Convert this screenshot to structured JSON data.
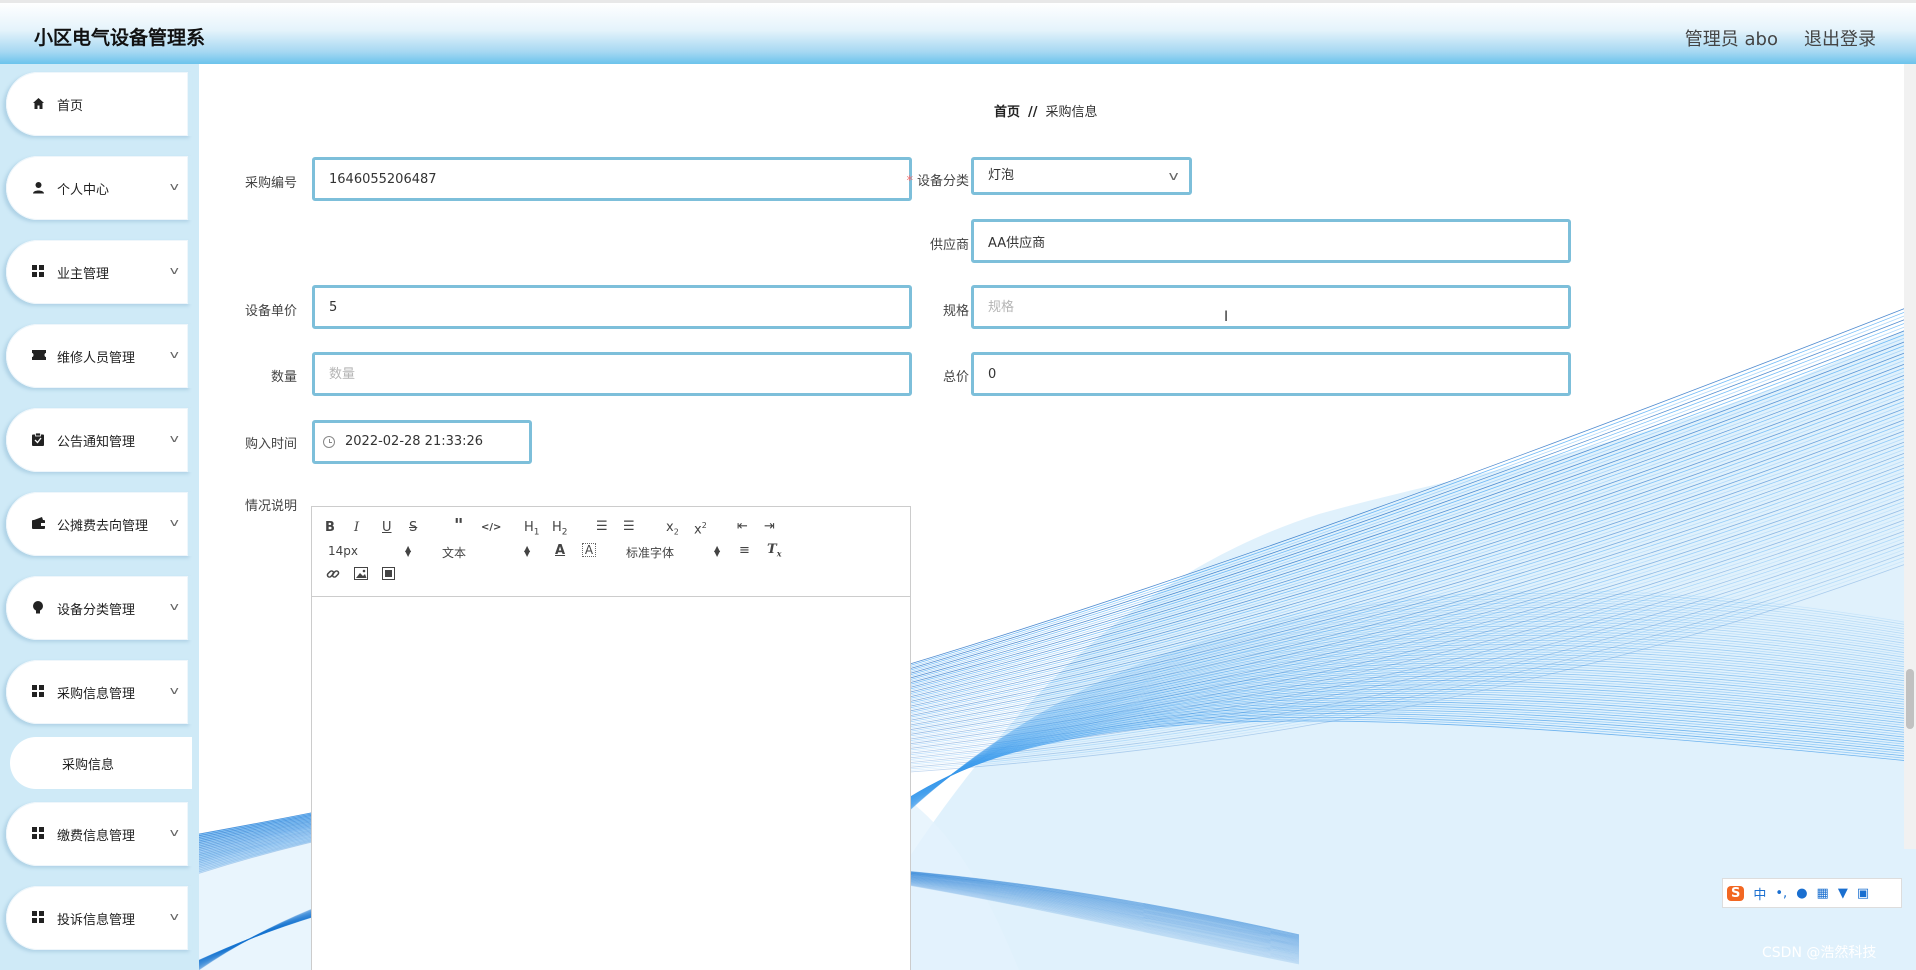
{
  "header": {
    "title": "小区电气设备管理系",
    "user": "管理员 abo",
    "logout": "退出登录"
  },
  "sidebar": {
    "items": [
      {
        "label": "首页",
        "icon": "home-icon",
        "glyph": "⌂"
      },
      {
        "label": "个人中心",
        "icon": "user-icon",
        "glyph": "●"
      },
      {
        "label": "业主管理",
        "icon": "grid-icon",
        "glyph": "▦"
      },
      {
        "label": "维修人员管理",
        "icon": "ticket-icon",
        "glyph": "✈"
      },
      {
        "label": "公告通知管理",
        "icon": "clipboard-icon",
        "glyph": "▤"
      },
      {
        "label": "公摊费去向管理",
        "icon": "wallet-icon",
        "glyph": "▣"
      },
      {
        "label": "设备分类管理",
        "icon": "bulb-icon",
        "glyph": "●"
      },
      {
        "label": "采购信息管理",
        "icon": "grid-icon",
        "glyph": "▦"
      },
      {
        "label": "缴费信息管理",
        "icon": "grid-icon",
        "glyph": "▦"
      },
      {
        "label": "投诉信息管理",
        "icon": "grid-icon",
        "glyph": "▦"
      }
    ],
    "submenu": {
      "label": "采购信息"
    }
  },
  "breadcrumb": {
    "home": "首页",
    "separator": "//",
    "current": "采购信息"
  },
  "form": {
    "purchase_no": {
      "label": "采购编号",
      "value": "1646055206487"
    },
    "category": {
      "label": "设备分类",
      "value": "灯泡"
    },
    "supplier": {
      "label": "供应商",
      "value": "AA供应商"
    },
    "unit_price": {
      "label": "设备单价",
      "value": "5"
    },
    "spec": {
      "label": "规格",
      "placeholder": "规格"
    },
    "quantity": {
      "label": "数量",
      "placeholder": "数量"
    },
    "total": {
      "label": "总价",
      "value": "0"
    },
    "purchase_time": {
      "label": "购入时间",
      "value": "2022-02-28 21:33:26"
    },
    "description": {
      "label": "情况说明"
    }
  },
  "editor": {
    "font_size": "14px",
    "text_type": "文本",
    "font_family": "标准字体"
  },
  "ime": {
    "logo": "S",
    "lang": "中"
  },
  "watermark": "CSDN @浩然科技",
  "colors": {
    "accent_border": "#7dbfda",
    "sidebar_bg": "#cfeaf7",
    "header_gradient_end": "#6cc3ec",
    "wave_blue": "#1e88e5",
    "required": "#f56c6c"
  }
}
